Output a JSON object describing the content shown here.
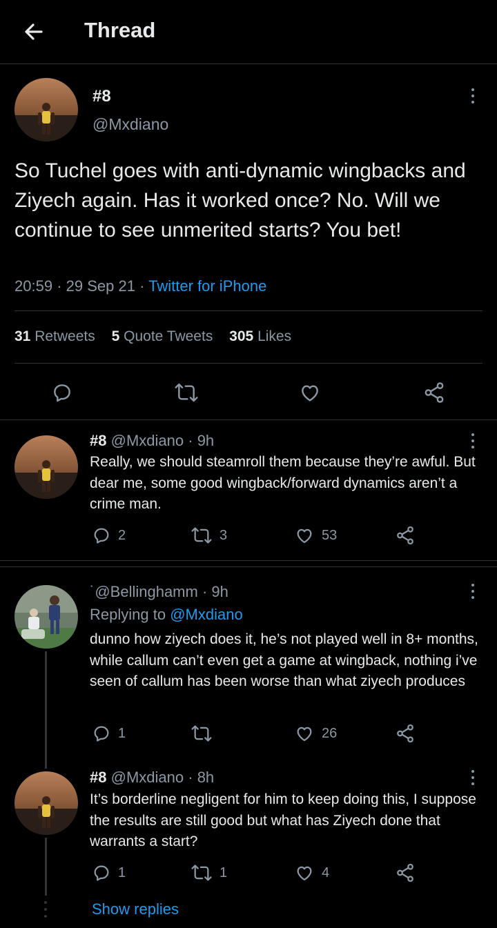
{
  "header": {
    "title": "Thread"
  },
  "main_tweet": {
    "name": "#8",
    "handle": "@Mxdiano",
    "text": "So Tuchel goes with anti-dynamic wingbacks and Ziyech again. Has it worked once? No. Will we continue to see unmerited starts? You bet!",
    "time": "20:59",
    "date": "29 Sep 21",
    "source": "Twitter for iPhone",
    "retweets_count": "31",
    "retweets_label": "Retweets",
    "quotes_count": "5",
    "quotes_label": "Quote Tweets",
    "likes_count": "305",
    "likes_label": "Likes"
  },
  "replies": [
    {
      "name": "#8",
      "handle": "@Mxdiano",
      "age": "9h",
      "text": "Really, we should steamroll them because they’re awful. But dear me, some good wingback/forward dynamics aren’t a crime man.",
      "reply_count": "2",
      "retweet_count": "3",
      "like_count": "53"
    },
    {
      "name": "",
      "handle": "˙@Bellinghamm",
      "age": "9h",
      "replying_label": "Replying to",
      "replying_to": "@Mxdiano",
      "text": "dunno how ziyech does it, he’s not played well in 8+ months, while callum can’t even get a game at wingback, nothing i’ve seen of callum has been worse than what ziyech produces",
      "reply_count": "1",
      "retweet_count": "",
      "like_count": "26"
    },
    {
      "name": "#8",
      "handle": "@Mxdiano",
      "age": "8h",
      "text": "It’s borderline negligent for him to keep doing this, I suppose the results are still good but what has Ziyech done that warrants a start?",
      "reply_count": "1",
      "retweet_count": "1",
      "like_count": "4"
    }
  ],
  "show_replies": "Show replies",
  "dot_sep": "·"
}
